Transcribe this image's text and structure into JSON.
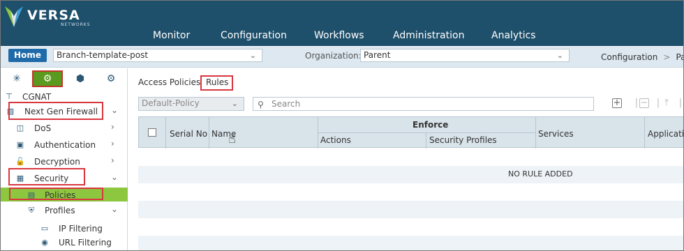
{
  "brand": {
    "name": "VERSA",
    "tagline": "NETWORKS"
  },
  "nav": [
    "Monitor",
    "Configuration",
    "Workflows",
    "Administration",
    "Analytics"
  ],
  "subbar": {
    "home_label": "Home",
    "template_value": "Branch-template-post",
    "org_label": "Organization:",
    "org_value": "Parent",
    "breadcrumb": [
      "Configuration",
      "Pa"
    ]
  },
  "sidebar": {
    "top_icons": [
      "network-icon",
      "gear-icon",
      "cube-icon",
      "services-icon"
    ],
    "items": [
      {
        "label": "CGNAT",
        "icon": "cgnat-icon"
      },
      {
        "label": "Next Gen Firewall",
        "icon": "firewall-icon",
        "expanded": true
      },
      {
        "label": "DoS",
        "icon": "dos-icon"
      },
      {
        "label": "Authentication",
        "icon": "auth-icon"
      },
      {
        "label": "Decryption",
        "icon": "lock-icon"
      },
      {
        "label": "Security",
        "icon": "security-icon",
        "expanded": true
      },
      {
        "label": "Policies",
        "icon": "policy-icon",
        "selected": true
      },
      {
        "label": "Profiles",
        "icon": "shield-icon",
        "expanded": true
      },
      {
        "label": "IP Filtering",
        "icon": "monitor-icon"
      },
      {
        "label": "URL Filtering",
        "icon": "globe-icon"
      }
    ]
  },
  "main": {
    "tabs": [
      "Access Policies",
      "Rules"
    ],
    "active_tab": "Rules",
    "policy_select": "Default-Policy",
    "search_placeholder": "Search",
    "table": {
      "headers": {
        "serial": "Serial No",
        "name": "Name",
        "enforce": "Enforce",
        "actions": "Actions",
        "security_profiles": "Security Profiles",
        "services": "Services",
        "applications": "Applicatio"
      },
      "empty_message": "NO RULE ADDED"
    }
  },
  "colors": {
    "header_bg": "#1e4f6b",
    "subbar_bg": "#dde8f0",
    "home_btn": "#1f6aa8",
    "selected_green": "#8dc63f",
    "highlight_red": "#d9363e"
  }
}
